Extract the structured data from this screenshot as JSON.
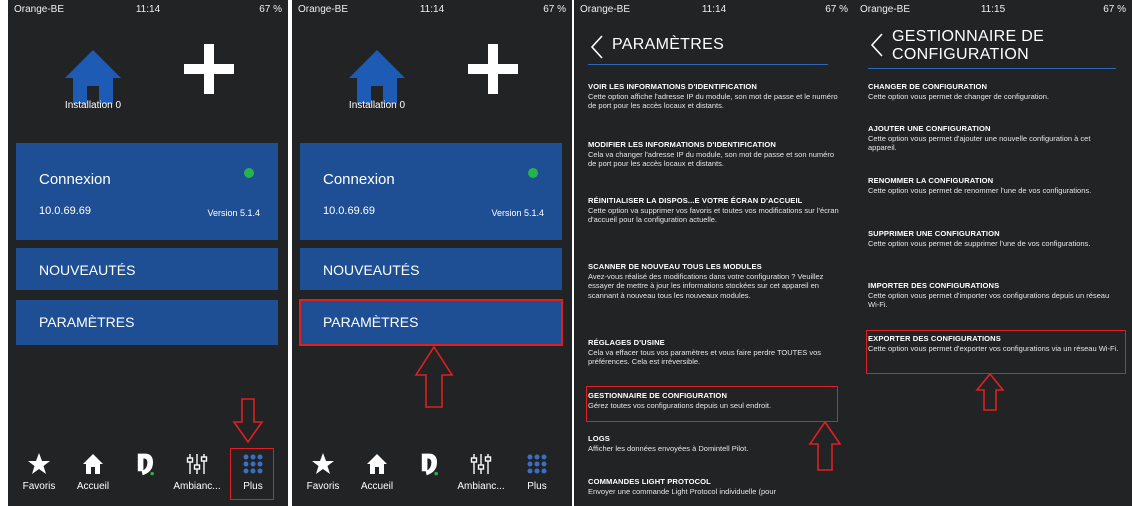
{
  "status": [
    {
      "carrier": "Orange-BE",
      "time": "11:14",
      "battery": "67 %"
    },
    {
      "carrier": "Orange-BE",
      "time": "11:14",
      "battery": "67 %"
    },
    {
      "carrier": "Orange-BE",
      "time": "11:14",
      "battery": "67 %"
    },
    {
      "carrier": "Orange-BE",
      "time": "11:15",
      "battery": "67 %"
    }
  ],
  "home": {
    "installation_label": "Installation 0",
    "connexion": {
      "title": "Connexion",
      "ip": "10.0.69.69",
      "version": "Version 5.1.4",
      "status_color": "#26b34a"
    },
    "nouveautes": "NOUVEAUTÉS",
    "parametres": "PARAMÈTRES"
  },
  "tabbar": [
    {
      "label": "Favoris",
      "icon": "star-icon"
    },
    {
      "label": "Accueil",
      "icon": "house-icon"
    },
    {
      "label": "",
      "icon": "domintell-logo-icon"
    },
    {
      "label": "Ambianc...",
      "icon": "sliders-icon"
    },
    {
      "label": "Plus",
      "icon": "grid-icon"
    }
  ],
  "parametres_screen": {
    "title": "PARAMÈTRES",
    "items": [
      {
        "title": "VOIR LES INFORMATIONS D'IDENTIFICATION",
        "desc": "Cette option affiche l'adresse IP du module, son mot de passe et le numéro de port pour les accès locaux et distants."
      },
      {
        "title": "MODIFIER LES INFORMATIONS D'IDENTIFICATION",
        "desc": "Cela va changer l'adresse IP du module, son mot de passe et son numéro de port pour les accès locaux et distants."
      },
      {
        "title": "RÉINITIALISER LA DISPOS...E VOTRE ÉCRAN D'ACCUEIL",
        "desc": "Cette option va supprimer vos favoris et toutes vos modifications sur l'écran d'accueil pour la configuration actuelle."
      },
      {
        "title": "SCANNER DE NOUVEAU TOUS LES MODULES",
        "desc": "Avez-vous réalisé des modifications dans votre configuration ? Veuillez essayer de mettre à jour les informations stockées sur cet appareil en scannant à nouveau tous les nouveaux modules."
      },
      {
        "title": "RÉGLAGES D'USINE",
        "desc": "Cela va effacer tous vos paramètres et vous faire perdre TOUTES vos préférences. Cela est irréversible."
      },
      {
        "title": "GESTIONNAIRE DE CONFIGURATION",
        "desc": "Gérez toutes vos configurations depuis un seul endroit."
      },
      {
        "title": "LOGS",
        "desc": "Afficher les données envoyées à Domintell Pilot."
      },
      {
        "title": "COMMANDES LIGHT PROTOCOL",
        "desc": "Envoyer une commande Light Protocol individuelle (pour"
      }
    ]
  },
  "gestionnaire_screen": {
    "title_line1": "GESTIONNAIRE DE",
    "title_line2": "CONFIGURATION",
    "items": [
      {
        "title": "CHANGER DE CONFIGURATION",
        "desc": "Cette option vous permet de changer de configuration."
      },
      {
        "title": "AJOUTER UNE CONFIGURATION",
        "desc": "Cette option vous permet d'ajouter une nouvelle configuration à cet appareil."
      },
      {
        "title": "RENOMMER LA CONFIGURATION",
        "desc": "Cette option vous permet de renommer l'une de vos configurations."
      },
      {
        "title": "SUPPRIMER UNE CONFIGURATION",
        "desc": "Cette option vous permet de supprimer l'une de vos configurations."
      },
      {
        "title": "IMPORTER DES CONFIGURATIONS",
        "desc": "Cette option vous permet d'importer vos configurations depuis un réseau Wi-Fi."
      },
      {
        "title": "EXPORTER DES CONFIGURATIONS",
        "desc": "Cette option vous permet d'exporter vos configurations via un réseau Wi-Fi."
      }
    ]
  },
  "colors": {
    "background": "#222325",
    "tile": "#1e4f95",
    "highlight": "#e02020",
    "accent_line": "#2c68b8"
  }
}
